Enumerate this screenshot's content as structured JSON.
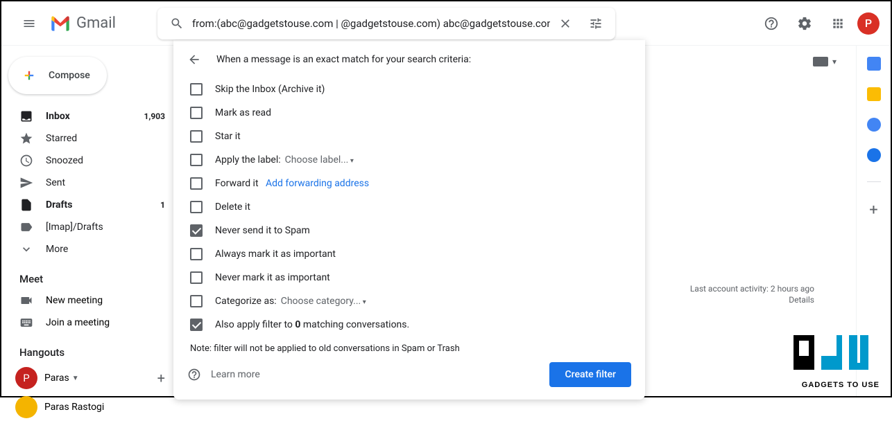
{
  "header": {
    "logo_text": "Gmail",
    "search_value": "from:(abc@gadgetstouse.com | @gadgetstouse.com) abc@gadgetstouse.com",
    "avatar_initial": "P"
  },
  "sidebar": {
    "compose": "Compose",
    "items": [
      {
        "label": "Inbox",
        "count": "1,903",
        "bold": true
      },
      {
        "label": "Starred"
      },
      {
        "label": "Snoozed"
      },
      {
        "label": "Sent"
      },
      {
        "label": "Drafts",
        "count": "1",
        "bold": true
      },
      {
        "label": "[Imap]/Drafts"
      },
      {
        "label": "More"
      }
    ],
    "meet_header": "Meet",
    "meet_items": [
      "New meeting",
      "Join a meeting"
    ],
    "hangouts_header": "Hangouts",
    "hangouts_user": "Paras",
    "hangouts_user2": "Paras Rastogi"
  },
  "filter": {
    "title": "When a message is an exact match for your search criteria:",
    "options": {
      "skip_inbox": "Skip the Inbox (Archive it)",
      "mark_read": "Mark as read",
      "star": "Star it",
      "apply_label": "Apply the label:",
      "label_select": "Choose label...",
      "forward": "Forward it",
      "forward_link": "Add forwarding address",
      "delete": "Delete it",
      "never_spam": "Never send it to Spam",
      "always_important": "Always mark it as important",
      "never_important": "Never mark it as important",
      "categorize": "Categorize as:",
      "category_select": "Choose category...",
      "also_apply_pre": "Also apply filter to ",
      "also_apply_count": "0",
      "also_apply_post": " matching conversations."
    },
    "note": "Note: filter will not be applied to old conversations in Spam or Trash",
    "learn_more": "Learn more",
    "create": "Create filter"
  },
  "footer": {
    "activity": "Last account activity: 2 hours ago",
    "details": "Details"
  },
  "watermark": "GADGETS TO USE"
}
